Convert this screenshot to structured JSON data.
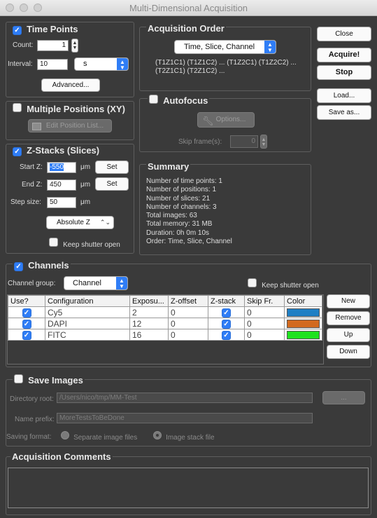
{
  "window": {
    "title": "Multi-Dimensional Acquisition"
  },
  "time_points": {
    "title": "Time Points",
    "enabled": true,
    "count_label": "Count:",
    "count_value": "1",
    "interval_label": "Interval:",
    "interval_value": "10",
    "interval_unit": "s",
    "advanced_label": "Advanced..."
  },
  "positions": {
    "title": "Multiple Positions (XY)",
    "enabled": false,
    "edit_label": "Edit Position List..."
  },
  "zstack": {
    "title": "Z-Stacks (Slices)",
    "enabled": true,
    "start_label": "Start Z:",
    "start_value": "-550",
    "end_label": "End Z:",
    "end_value": "450",
    "step_label": "Step size:",
    "step_value": "50",
    "unit": "μm",
    "set_label": "Set",
    "mode": "Absolute Z",
    "keep_shutter": "Keep shutter open"
  },
  "order": {
    "title": "Acquisition Order",
    "value": "Time, Slice, Channel",
    "line1": "(T1Z1C1) (T1Z1C2) ... (T1Z2C1) (T1Z2C2) ...",
    "line2": "(T2Z1C1) (T2Z1C2) ..."
  },
  "autofocus": {
    "title": "Autofocus",
    "enabled": false,
    "options_label": "Options...",
    "skip_label": "Skip frame(s):",
    "skip_value": "0"
  },
  "summary": {
    "title": "Summary",
    "lines": [
      "Number of time points: 1",
      "Number of positions: 1",
      "Number of slices: 21",
      "Number of channels: 3",
      "Total images: 63",
      "Total memory: 31 MB",
      "Duration: 0h 0m 10s",
      "Order: Time, Slice, Channel"
    ]
  },
  "buttons": {
    "close": "Close",
    "acquire": "Acquire!",
    "stop": "Stop",
    "load": "Load...",
    "save_as": "Save as..."
  },
  "channels": {
    "title": "Channels",
    "enabled": true,
    "group_label": "Channel group:",
    "group_value": "Channel",
    "keep_shutter": "Keep shutter open",
    "headers": [
      "Use?",
      "Configuration",
      "Exposu...",
      "Z-offset",
      "Z-stack",
      "Skip Fr.",
      "Color"
    ],
    "rows": [
      {
        "use": true,
        "config": "Cy5",
        "exposure": "2",
        "zoffset": "0",
        "zstack": true,
        "skip": "0",
        "color": "#1f7fc4"
      },
      {
        "use": true,
        "config": "DAPI",
        "exposure": "12",
        "zoffset": "0",
        "zstack": true,
        "skip": "0",
        "color": "#d2691e"
      },
      {
        "use": true,
        "config": "FITC",
        "exposure": "16",
        "zoffset": "0",
        "zstack": true,
        "skip": "0",
        "color": "#1fe21f"
      }
    ],
    "new_label": "New",
    "remove_label": "Remove",
    "up_label": "Up",
    "down_label": "Down"
  },
  "save": {
    "title": "Save Images",
    "enabled": false,
    "root_label": "Directory root:",
    "root_value": "/Users/nico/tmp/MM-Test",
    "browse_label": "...",
    "prefix_label": "Name prefix:",
    "prefix_value": "MoreTestsToBeDone",
    "format_label": "Saving format:",
    "opt_separate": "Separate image files",
    "opt_stack": "Image stack file"
  },
  "comments": {
    "title": "Acquisition Comments"
  }
}
